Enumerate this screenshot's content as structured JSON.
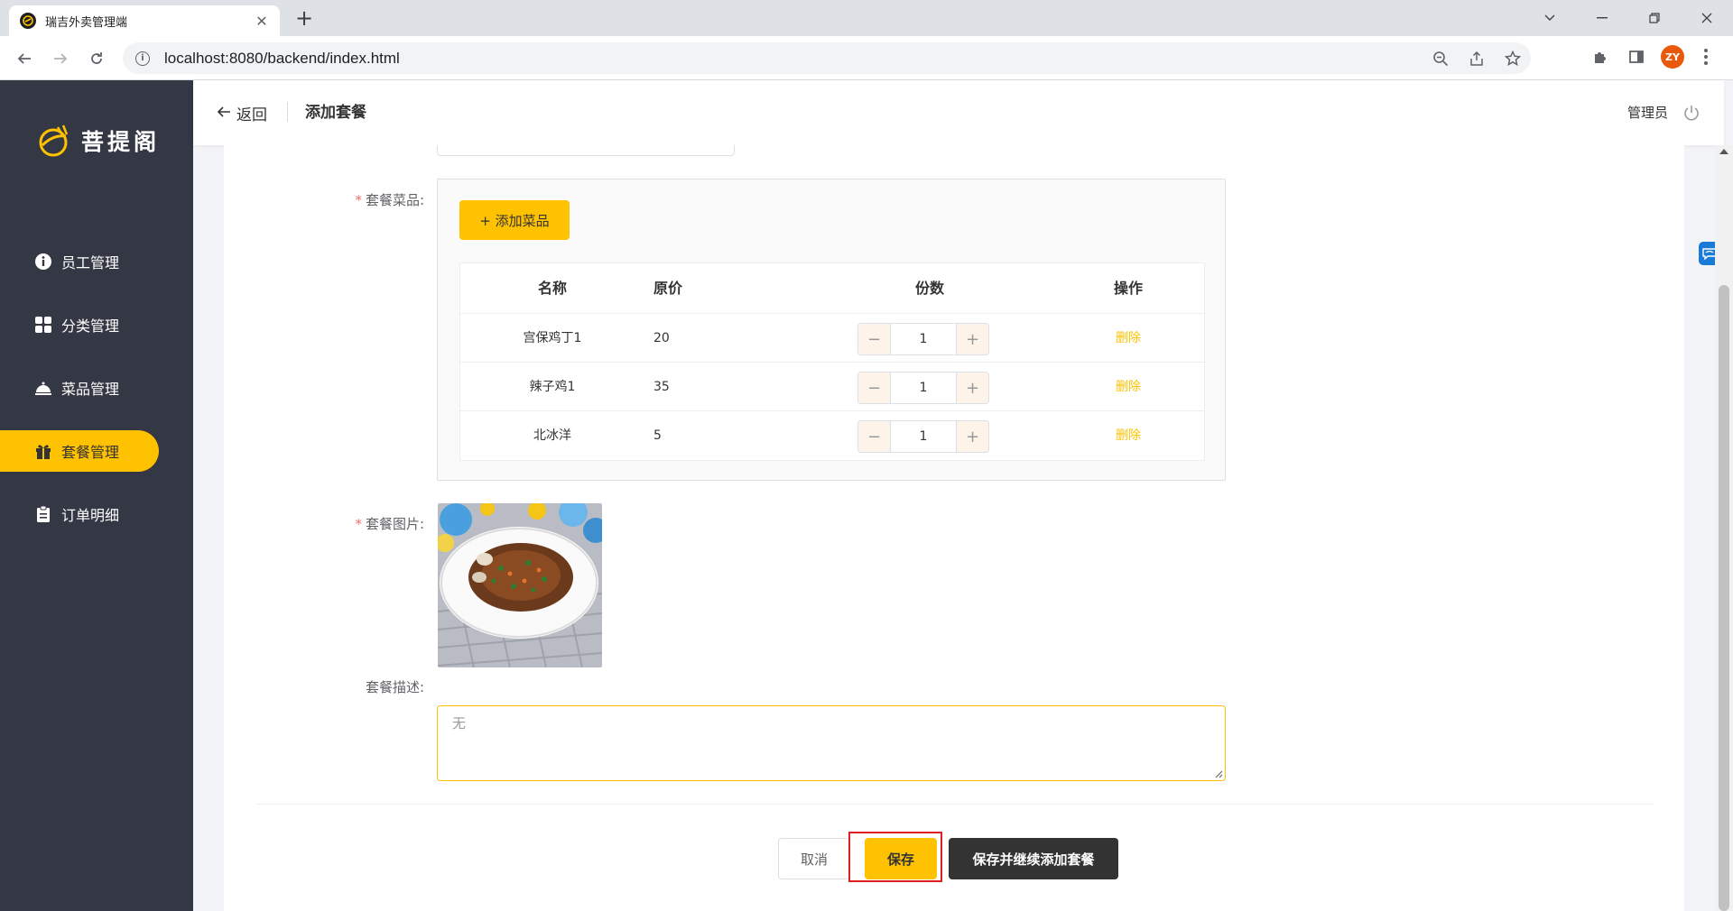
{
  "browser": {
    "tab_title": "瑞吉外卖管理端",
    "url": "localhost:8080/backend/index.html",
    "avatar_initials": "ZY"
  },
  "sidebar": {
    "logo_text": "菩提阁",
    "items": [
      {
        "label": "员工管理",
        "icon": "employee-icon",
        "active": false
      },
      {
        "label": "分类管理",
        "icon": "category-icon",
        "active": false
      },
      {
        "label": "菜品管理",
        "icon": "dish-icon",
        "active": false
      },
      {
        "label": "套餐管理",
        "icon": "setmeal-icon",
        "active": true
      },
      {
        "label": "订单明细",
        "icon": "order-icon",
        "active": false
      }
    ]
  },
  "header": {
    "back_label": "返回",
    "title": "添加套餐",
    "user": "管理员"
  },
  "form": {
    "dishes_label": "套餐菜品:",
    "add_dish_button": "+ 添加菜品",
    "table": {
      "columns": [
        "名称",
        "原价",
        "份数",
        "操作"
      ],
      "rows": [
        {
          "name": "宫保鸡丁1",
          "price": "20",
          "qty": "1",
          "action": "删除"
        },
        {
          "name": "辣子鸡1",
          "price": "35",
          "qty": "1",
          "action": "删除"
        },
        {
          "name": "北冰洋",
          "price": "5",
          "qty": "1",
          "action": "删除"
        }
      ]
    },
    "image_label": "套餐图片:",
    "desc_label": "套餐描述:",
    "desc_value": "无"
  },
  "buttons": {
    "cancel": "取消",
    "save": "保存",
    "save_continue": "保存并继续添加套餐"
  },
  "colors": {
    "accent": "#ffc200",
    "sidebar_bg": "#343744",
    "highlight": "#e02020"
  }
}
